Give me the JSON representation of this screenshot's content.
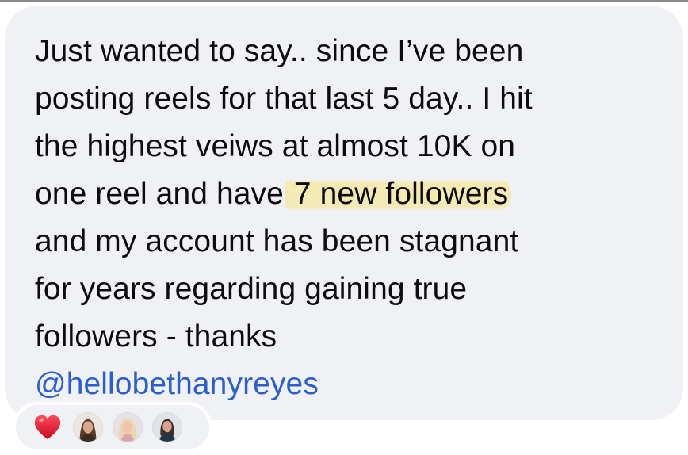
{
  "comment": {
    "lines": [
      "Just wanted to say.. since I’ve been",
      "posting reels for that last 5 day.. I hit",
      "the highest veiws at almost 10K on"
    ],
    "line4_before": "one reel and have ",
    "line4_highlight": "7 new followers",
    "lines_after": [
      "and my account has been stagnant",
      "for years regarding gaining true",
      "followers - thanks"
    ],
    "mention": "@hellobethanyreyes"
  },
  "reactions": {
    "emoji": "heart-icon",
    "avatars": [
      "avatar-reactor-1",
      "avatar-reactor-2",
      "avatar-reactor-3"
    ]
  },
  "colors": {
    "bubble": "#f0f1f4",
    "text": "#0d0d0f",
    "mention": "#2b5fce",
    "highlight": "#f6e8a4",
    "heart": "#e0152d"
  }
}
